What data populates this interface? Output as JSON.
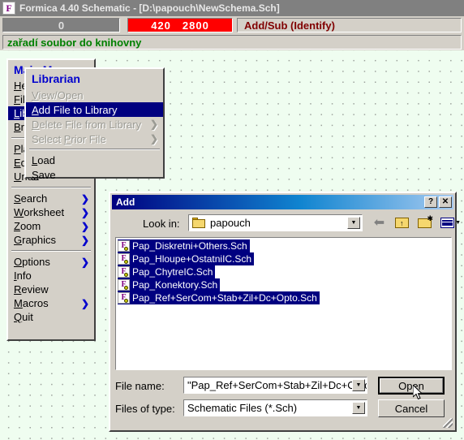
{
  "window": {
    "title": "Formica 4.40 Schematic - [D:\\papouch\\NewSchema.Sch]",
    "icon": "formica-app-icon",
    "icon_letter": "F"
  },
  "toolbar": {
    "count": "0",
    "coord_x": "420",
    "coord_y": "2800",
    "mode": "Add/Sub (Identify)",
    "colors": {
      "count_bg": "#808080",
      "coords_bg": "#ff0000",
      "mode_text": "#800000"
    }
  },
  "statusbar": {
    "text": "zařadí soubor do knihovny",
    "color": "#008000"
  },
  "main_menu": {
    "title": "Main Menu",
    "items": [
      {
        "label": "Help",
        "mnemonic": "H",
        "arrow": "",
        "selected": false
      },
      {
        "label": "File",
        "mnemonic": "F",
        "arrow": "",
        "selected": false
      },
      {
        "label": "Librarian",
        "mnemonic": "L",
        "arrow": "",
        "selected": true
      },
      {
        "label": "Browse",
        "mnemonic": "B",
        "arrow": "",
        "selected": false
      },
      {
        "separator": true
      },
      {
        "label": "Place",
        "mnemonic": "P",
        "arrow": "",
        "selected": false
      },
      {
        "label": "Edit",
        "mnemonic": "E",
        "arrow": "",
        "selected": false
      },
      {
        "label": "Undo",
        "mnemonic": "U",
        "arrow": "",
        "selected": false
      },
      {
        "separator": true
      },
      {
        "label": "Search",
        "mnemonic": "S",
        "arrow": "❯",
        "selected": false
      },
      {
        "label": "Worksheet",
        "mnemonic": "W",
        "arrow": "❯",
        "selected": false
      },
      {
        "label": "Zoom",
        "mnemonic": "Z",
        "arrow": "❯",
        "selected": false
      },
      {
        "label": "Graphics",
        "mnemonic": "G",
        "arrow": "❯",
        "selected": false
      },
      {
        "separator": true
      },
      {
        "label": "Options",
        "mnemonic": "O",
        "arrow": "❯",
        "selected": false
      },
      {
        "label": "Info",
        "mnemonic": "I",
        "arrow": "",
        "selected": false
      },
      {
        "label": "Review",
        "mnemonic": "R",
        "arrow": "",
        "selected": false
      },
      {
        "label": "Macros",
        "mnemonic": "M",
        "arrow": "❯",
        "selected": false
      },
      {
        "label": "Quit",
        "mnemonic": "Q",
        "arrow": "",
        "selected": false
      }
    ]
  },
  "librarian_menu": {
    "title": "Librarian",
    "items": [
      {
        "label": "View/Open",
        "mnemonic": "V",
        "arrow": "",
        "enabled": false,
        "selected": false
      },
      {
        "label": "Add File to Library",
        "mnemonic": "A",
        "arrow": "",
        "enabled": true,
        "selected": true
      },
      {
        "label": "Delete File from Library",
        "mnemonic": "D",
        "arrow": "❯",
        "enabled": false,
        "selected": false
      },
      {
        "label": "Select Prior File",
        "mnemonic": "P",
        "arrow": "❯",
        "enabled": false,
        "selected": false
      },
      {
        "separator": true
      },
      {
        "label": "Load",
        "mnemonic": "L",
        "arrow": "",
        "enabled": true,
        "selected": false
      },
      {
        "label": "Save",
        "mnemonic": "S",
        "arrow": "",
        "enabled": true,
        "selected": false
      }
    ]
  },
  "dialog": {
    "title": "Add",
    "help_button": "?",
    "close_button": "✕",
    "lookin_label": "Look in:",
    "lookin_value": "papouch",
    "nav_icons": [
      "back-arrow-icon",
      "up-one-level-icon",
      "new-folder-icon",
      "view-menu-icon"
    ],
    "files": [
      {
        "name": "Pap_Diskretni+Others.Sch",
        "selected": true
      },
      {
        "name": "Pap_Hloupe+OstatniIC.Sch",
        "selected": true
      },
      {
        "name": "Pap_ChytreIC.Sch",
        "selected": true
      },
      {
        "name": "Pap_Konektory.Sch",
        "selected": true
      },
      {
        "name": "Pap_Ref+SerCom+Stab+Zil+Dc+Opto.Sch",
        "selected": true
      }
    ],
    "filename_label": "File name:",
    "filename_value": "\"Pap_Ref+SerCom+Stab+Zil+Dc+Opto.Sch\"",
    "filetype_label": "Files of type:",
    "filetype_value": "Schematic Files (*.Sch)",
    "open_button": "Open",
    "cancel_button": "Cancel"
  }
}
